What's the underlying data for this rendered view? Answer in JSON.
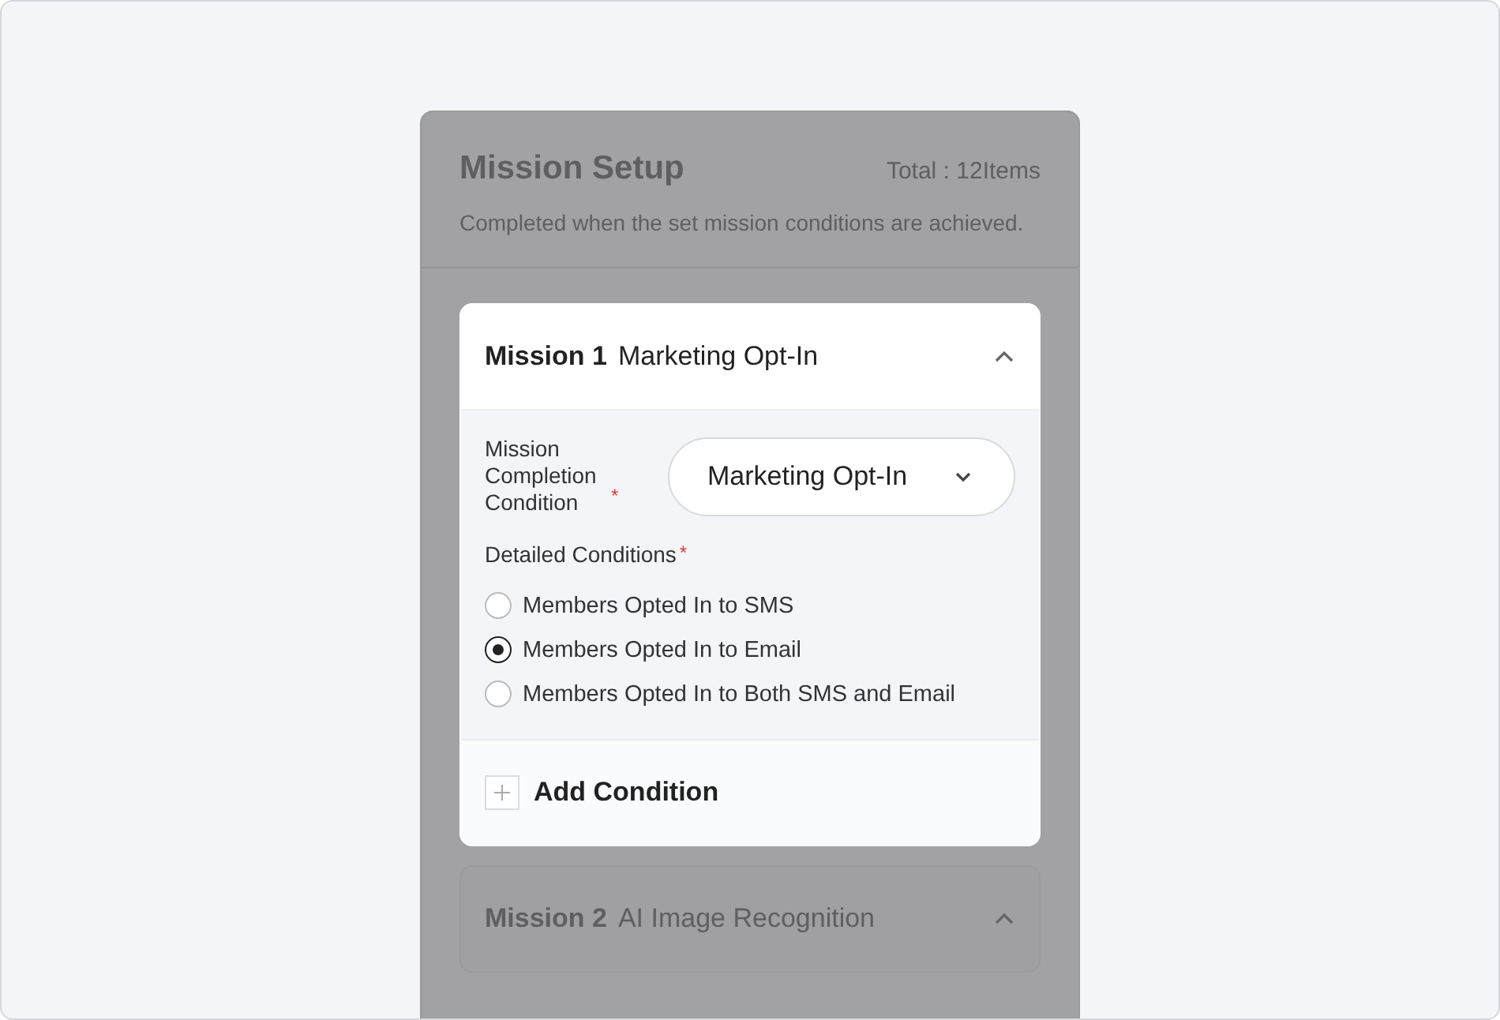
{
  "panel": {
    "title": "Mission Setup",
    "total": "Total : 12Items",
    "description": "Completed when the set mission conditions are achieved.",
    "dimmed": true
  },
  "missions": [
    {
      "number": "Mission 1",
      "name": "Marketing Opt-In",
      "focused": true,
      "expanded": true,
      "completion": {
        "label": "Mission Completion Condition",
        "required_mark": "*",
        "value": "Marketing Opt-In"
      },
      "details": {
        "label": "Detailed Conditions",
        "required_mark": "*",
        "options": [
          {
            "label": "Members Opted In to SMS",
            "selected": false
          },
          {
            "label": "Members Opted In to Email",
            "selected": true
          },
          {
            "label": "Members Opted In to Both SMS and Email",
            "selected": false
          }
        ]
      },
      "add_label": "Add Condition"
    },
    {
      "number": "Mission 2",
      "name": "AI Image Recognition",
      "focused": false,
      "expanded": true
    }
  ]
}
